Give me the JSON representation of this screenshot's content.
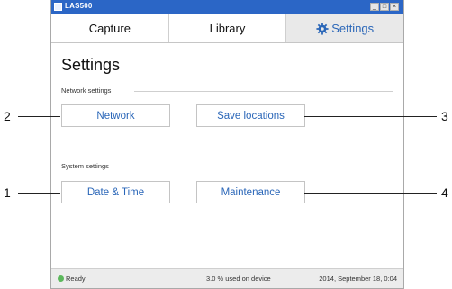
{
  "window": {
    "title": "LAS500"
  },
  "tabs": [
    {
      "label": "Capture"
    },
    {
      "label": "Library"
    },
    {
      "label": "Settings"
    }
  ],
  "page": {
    "title": "Settings"
  },
  "network_settings": {
    "label": "Network settings",
    "buttons": {
      "network": "Network",
      "save_locations": "Save locations"
    }
  },
  "system_settings": {
    "label": "System settings",
    "buttons": {
      "date_time": "Date & Time",
      "maintenance": "Maintenance"
    }
  },
  "status": {
    "ready": "Ready",
    "usage": "3.0 % used on device",
    "datetime": "2014, September 18, 0:04"
  },
  "callouts": {
    "n1": "1",
    "n2": "2",
    "n3": "3",
    "n4": "4"
  },
  "colors": {
    "accent": "#2a66b8",
    "titlebar": "#2b66c6",
    "ready": "#5cb85c"
  }
}
